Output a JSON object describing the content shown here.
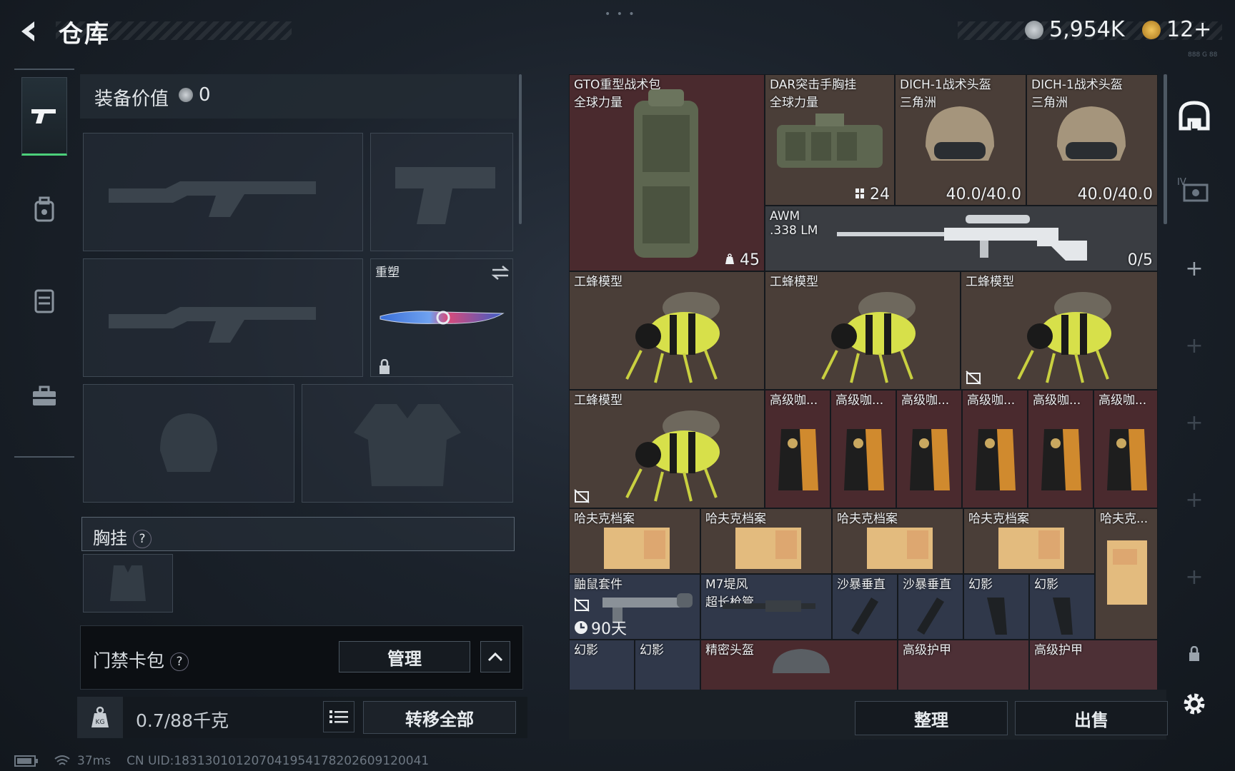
{
  "header": {
    "title": "仓库",
    "currency_silver": "5,954K",
    "currency_gold": "12+",
    "dots": "• • •",
    "version_text": "888 G 88"
  },
  "tabs": [
    {
      "icon": "gun-icon",
      "active": true
    },
    {
      "icon": "backpack-icon",
      "active": false
    },
    {
      "icon": "vest-icon",
      "active": false
    },
    {
      "icon": "toolbox-icon",
      "active": false
    }
  ],
  "equipment": {
    "value_label": "装备价值",
    "value": "0",
    "slots": [
      {
        "name": "primary-weapon-slot-1",
        "label": ""
      },
      {
        "name": "pistol-slot",
        "label": ""
      },
      {
        "name": "primary-weapon-slot-2",
        "label": ""
      },
      {
        "name": "melee-slot",
        "label": "重塑"
      },
      {
        "name": "helmet-slot",
        "label": ""
      },
      {
        "name": "armor-slot",
        "label": ""
      }
    ],
    "chest_rig_label": "胸挂",
    "chest_rig_help": "?",
    "access_card_label": "门禁卡包",
    "access_card_help": "?",
    "manage_label": "管理",
    "weight": "0.7/88千克",
    "transfer_all_label": "转移全部"
  },
  "status": {
    "ping": "37ms",
    "uid": "CN UID:18313010120704195417820260912​0041"
  },
  "stash": {
    "items": [
      {
        "name": "GTO重型战术包",
        "sub": "全球力量",
        "value": "45",
        "value_icon": "weight-icon",
        "color": "red"
      },
      {
        "name": "DAR突击手胸挂",
        "sub": "全球力量",
        "value": "24",
        "value_icon": "slots-icon",
        "color": "brown"
      },
      {
        "name": "DICH-1战术头盔",
        "sub": "三角洲",
        "value": "40.0/40.0",
        "color": "brown"
      },
      {
        "name": "DICH-1战术头盔",
        "sub": "三角洲",
        "value": "40.0/40.0",
        "color": "brown"
      },
      {
        "name": "AWM",
        "sub": ".338 LM",
        "value": "0/5",
        "color": "gray"
      },
      {
        "name": "工蜂模型",
        "color": "brown"
      },
      {
        "name": "工蜂模型",
        "color": "brown"
      },
      {
        "name": "工蜂模型",
        "color": "brown"
      },
      {
        "name": "工蜂模型",
        "color": "brown"
      },
      {
        "name": "高级咖...",
        "color": "red"
      },
      {
        "name": "高级咖...",
        "color": "red"
      },
      {
        "name": "高级咖...",
        "color": "red"
      },
      {
        "name": "高级咖...",
        "color": "red"
      },
      {
        "name": "高级咖...",
        "color": "red"
      },
      {
        "name": "高级咖...",
        "color": "red"
      },
      {
        "name": "哈夫克档案",
        "color": "brown"
      },
      {
        "name": "哈夫克档案",
        "color": "brown"
      },
      {
        "name": "哈夫克档案",
        "color": "brown"
      },
      {
        "name": "哈夫克档案",
        "color": "brown"
      },
      {
        "name": "哈夫克...",
        "color": "brown"
      },
      {
        "name": "鼬鼠套件",
        "timer": "90天",
        "color": "slate"
      },
      {
        "name": "M7堤风",
        "sub": "超长枪管",
        "color": "slate"
      },
      {
        "name": "沙暴垂直",
        "color": "slate"
      },
      {
        "name": "沙暴垂直",
        "color": "slate"
      },
      {
        "name": "幻影",
        "color": "slate"
      },
      {
        "name": "幻影",
        "color": "slate"
      },
      {
        "name": "幻影",
        "color": "slate"
      },
      {
        "name": "幻影",
        "color": "slate"
      },
      {
        "name": "精密头盔",
        "color": "red"
      },
      {
        "name": "高级护甲",
        "color": "rose"
      },
      {
        "name": "高级护甲",
        "color": "rose"
      }
    ],
    "sort_label": "整理",
    "sell_label": "出售"
  },
  "colors": {
    "accent_green": "#4cd07a",
    "rarity_red": "#4a2a2e",
    "rarity_brown": "#4a3e38",
    "rarity_slate": "#30384a"
  }
}
